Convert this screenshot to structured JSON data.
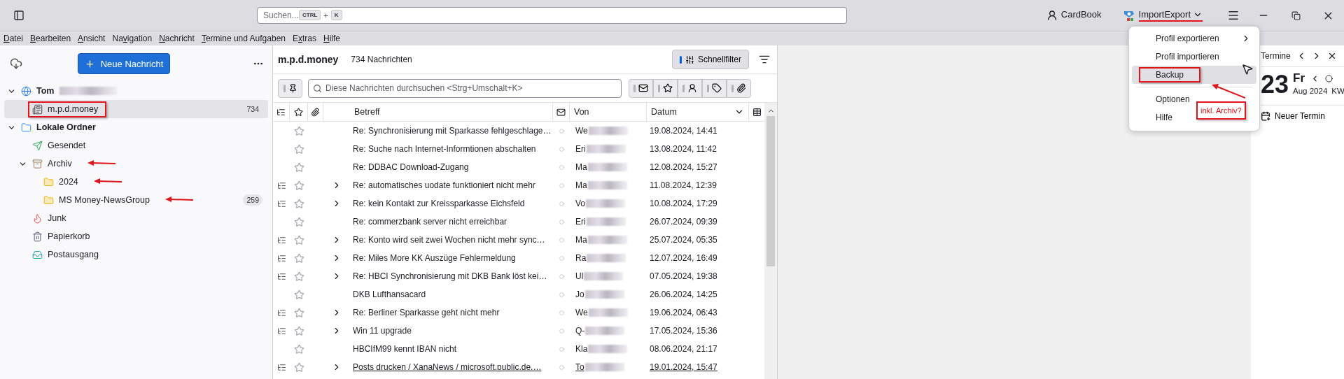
{
  "toolbar": {
    "search": {
      "placeholder": "Suchen...",
      "keys": [
        "CTRL",
        "K"
      ],
      "joiner": "+"
    },
    "addons": [
      {
        "kind": "cardbook",
        "label": "CardBook",
        "annotated": false
      },
      {
        "kind": "importexport",
        "label": "ImportExport",
        "annotated": true
      }
    ]
  },
  "menubar": [
    {
      "key": "D",
      "after": "atei"
    },
    {
      "key": "B",
      "after": "earbeiten"
    },
    {
      "key": "A",
      "after": "nsicht"
    },
    {
      "before": "Na",
      "key": "v",
      "after": "igation"
    },
    {
      "key": "N",
      "after": "achricht"
    },
    {
      "key": "T",
      "after": "ermine und Aufgaben"
    },
    {
      "before": "E",
      "key": "x",
      "after": "tras"
    },
    {
      "key": "H",
      "after": "ilfe"
    }
  ],
  "folder_pane": {
    "new_message_button": "Neue Nachricht",
    "tree": [
      {
        "kind": "account",
        "label": "Tom",
        "redacted": true,
        "selected": false,
        "expanded": true,
        "children": [
          {
            "kind": "newsgroup",
            "label": "m.p.d.money",
            "count": "734",
            "selected": true,
            "boxed": true
          }
        ]
      },
      {
        "kind": "local",
        "label": "Lokale Ordner",
        "selected": false,
        "expanded": true,
        "children": [
          {
            "kind": "sent",
            "label": "Gesendet",
            "selected": false
          },
          {
            "kind": "archive",
            "label": "Archiv",
            "selected": false,
            "expanded": true,
            "arrowed": true,
            "children": [
              {
                "kind": "folder",
                "label": "2024",
                "selected": false,
                "arrowed": true
              },
              {
                "kind": "folder",
                "label": "MS Money-NewsGroup",
                "count": "259",
                "selected": false,
                "arrowed": true
              }
            ]
          },
          {
            "kind": "junk",
            "label": "Junk",
            "selected": false
          },
          {
            "kind": "trash",
            "label": "Papierkorb",
            "selected": false
          },
          {
            "kind": "outbox",
            "label": "Postausgang",
            "selected": false
          }
        ]
      }
    ]
  },
  "message_list": {
    "folder_name": "m.p.d.money",
    "count": "734 Nachrichten",
    "quick_filter": {
      "label": "Schnellfilter",
      "on": true
    },
    "filter_bar": {
      "placeholder": "Diese Nachrichten durchsuchen <Strg+Umschalt+K>",
      "pinned": false,
      "toggles": [
        {
          "kind": "unread",
          "on": false
        },
        {
          "kind": "starred",
          "on": false
        },
        {
          "kind": "contact",
          "on": false
        },
        {
          "kind": "tags",
          "on": false
        },
        {
          "kind": "attachment",
          "on": false
        }
      ]
    },
    "columns": [
      {
        "kind": "thread"
      },
      {
        "kind": "star"
      },
      {
        "kind": "attachment"
      },
      {
        "kind": "spacer"
      },
      {
        "kind": "text",
        "label": "Betreff"
      },
      {
        "kind": "status"
      },
      {
        "kind": "text",
        "label": "Von"
      },
      {
        "kind": "text",
        "label": "Datum",
        "sorted": true
      },
      {
        "kind": "picker"
      }
    ],
    "rows": [
      {
        "thread": false,
        "starred": false,
        "read": true,
        "subject": "Re: Synchronisierung mit Sparkasse fehlgeschlage…",
        "sender": "We",
        "redacted": true,
        "date": "19.08.2024, 14:41",
        "hovered": false
      },
      {
        "thread": false,
        "starred": false,
        "read": true,
        "subject": "Re: Suche nach Internet-Informtionen abschalten",
        "sender": "Eri",
        "redacted": true,
        "date": "13.08.2024, 11:42",
        "hovered": false
      },
      {
        "thread": false,
        "starred": false,
        "read": true,
        "subject": "Re: DDBAC Download-Zugang",
        "sender": "Ma",
        "redacted": true,
        "date": "12.08.2024, 15:27",
        "hovered": false
      },
      {
        "thread": true,
        "starred": false,
        "read": true,
        "subject": "Re: automatisches uodate funktioniert nicht mehr",
        "sender": "Ma",
        "redacted": true,
        "date": "11.08.2024, 12:39",
        "hovered": false
      },
      {
        "thread": true,
        "starred": false,
        "read": true,
        "subject": "Re: kein Kontakt zur Kreissparkasse Eichsfeld",
        "sender": "Vo",
        "redacted": true,
        "date": "10.08.2024, 17:29",
        "hovered": false
      },
      {
        "thread": false,
        "starred": false,
        "read": true,
        "subject": "Re: commerzbank server nicht erreichbar",
        "sender": "Eri",
        "redacted": true,
        "date": "26.07.2024, 09:39",
        "hovered": false
      },
      {
        "thread": true,
        "starred": false,
        "read": true,
        "subject": "Re: Konto wird seit zwei Wochen nicht mehr sync…",
        "sender": "Ma",
        "redacted": true,
        "date": "25.07.2024, 05:35",
        "hovered": false
      },
      {
        "thread": true,
        "starred": false,
        "read": true,
        "subject": "Re: Miles More KK Auszüge Fehlermeldung",
        "sender": "Ra",
        "redacted": true,
        "date": "12.07.2024, 16:49",
        "hovered": false
      },
      {
        "thread": true,
        "starred": false,
        "read": true,
        "subject": "Re: HBCI Synchronisierung mit DKB Bank löst kei…",
        "sender": "Ul",
        "redacted": true,
        "date": "07.05.2024, 19:38",
        "hovered": false
      },
      {
        "thread": false,
        "starred": false,
        "read": true,
        "subject": "DKB Lufthansacard",
        "sender": "Jo",
        "redacted": true,
        "date": "26.06.2024, 14:25",
        "hovered": false
      },
      {
        "thread": true,
        "starred": false,
        "read": true,
        "subject": "Re: Berliner Sparkasse geht nicht mehr",
        "sender": "We",
        "redacted": true,
        "date": "19.06.2024, 06:43",
        "hovered": false
      },
      {
        "thread": true,
        "starred": false,
        "read": true,
        "subject": "Win 11 upgrade",
        "sender": "Q-",
        "redacted": true,
        "date": "17.05.2024, 15:36",
        "hovered": false
      },
      {
        "thread": false,
        "starred": false,
        "read": true,
        "subject": "HBCIfM99 kennt IBAN nicht",
        "sender": "Kla",
        "redacted": true,
        "date": "08.06.2024, 21:17",
        "hovered": false
      },
      {
        "thread": true,
        "starred": false,
        "read": true,
        "subject": "Posts drucken / XanaNews / microsoft.public.de.…",
        "sender": "To",
        "redacted": true,
        "date": "19.01.2024, 15:47",
        "hovered": true
      }
    ]
  },
  "today_pane": {
    "title": "Termine",
    "day": "23",
    "weekday": "Fr",
    "month": "Aug 2024",
    "week": "KW",
    "new_event": "Neuer Termin"
  },
  "addon_menu": {
    "items": [
      {
        "label": "Profil exportieren",
        "submenu": true,
        "hovered": false,
        "annotated": false
      },
      {
        "label": "Profil importieren",
        "submenu": false,
        "hovered": false,
        "annotated": false
      },
      {
        "label": "Backup",
        "submenu": false,
        "hovered": true,
        "annotated": true,
        "separator_after": true
      },
      {
        "label": "Optionen",
        "submenu": false,
        "hovered": false,
        "annotated": false
      },
      {
        "label": "Hilfe",
        "submenu": false,
        "hovered": false,
        "annotated": false
      }
    ],
    "note": "inkl. Archiv?"
  }
}
